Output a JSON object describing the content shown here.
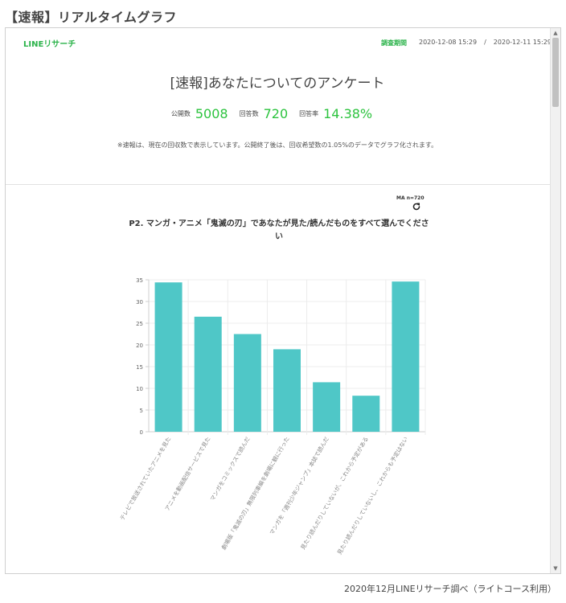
{
  "page": {
    "heading": "【速報】リアルタイムグラフ",
    "source_note": "2020年12月LINEリサーチ調べ（ライトコース利用）"
  },
  "survey": {
    "logo": "LINEリサーチ",
    "period_label": "調査期間",
    "period_start": "2020-12-08 15:29",
    "period_sep": "/",
    "period_end": "2020-12-11 15:29",
    "title": "[速報]あなたについてのアンケート",
    "stats": [
      {
        "label": "公開数",
        "value": "5008"
      },
      {
        "label": "回答数",
        "value": "720"
      },
      {
        "label": "回答率",
        "value": "14.38%"
      }
    ],
    "note": "※速報は、現在の回収数で表示しています。公開終了後は、回収希望数の1.05%のデータでグラフ化されます。",
    "ma_label": "MA n=720",
    "question": "P2. マンガ・アニメ「鬼滅の刃」であなたが見た/読んだものをすべて選んでください"
  },
  "icons": {
    "refresh": "refresh-icon",
    "scroll_up": "triangle-up-icon",
    "scroll_down": "triangle-down-icon"
  },
  "colors": {
    "bar": "#4fc7c7",
    "accent_green": "#2cc33e",
    "logo_green": "#2bb34a"
  },
  "chart_data": {
    "type": "bar",
    "categories": [
      "テレビで放送されていたアニメを見た",
      "アニメを動画配信サービスで見た",
      "マンガをコミックスで読んだ",
      "劇場版「鬼滅の刃」無限列車編を劇場に観に行った",
      "マンガを「週刊少年ジャンプ」本誌で読んだ",
      "見たり読んだりしていないが、これから予定がある",
      "見たり読んだりしていないし、これからも予定はない"
    ],
    "values": [
      34.4,
      26.5,
      22.5,
      19.0,
      11.4,
      8.3,
      34.6
    ],
    "yticks": [
      0,
      5,
      10,
      15,
      20,
      25,
      30,
      35
    ],
    "ylim": [
      0,
      35
    ],
    "grid": true
  }
}
